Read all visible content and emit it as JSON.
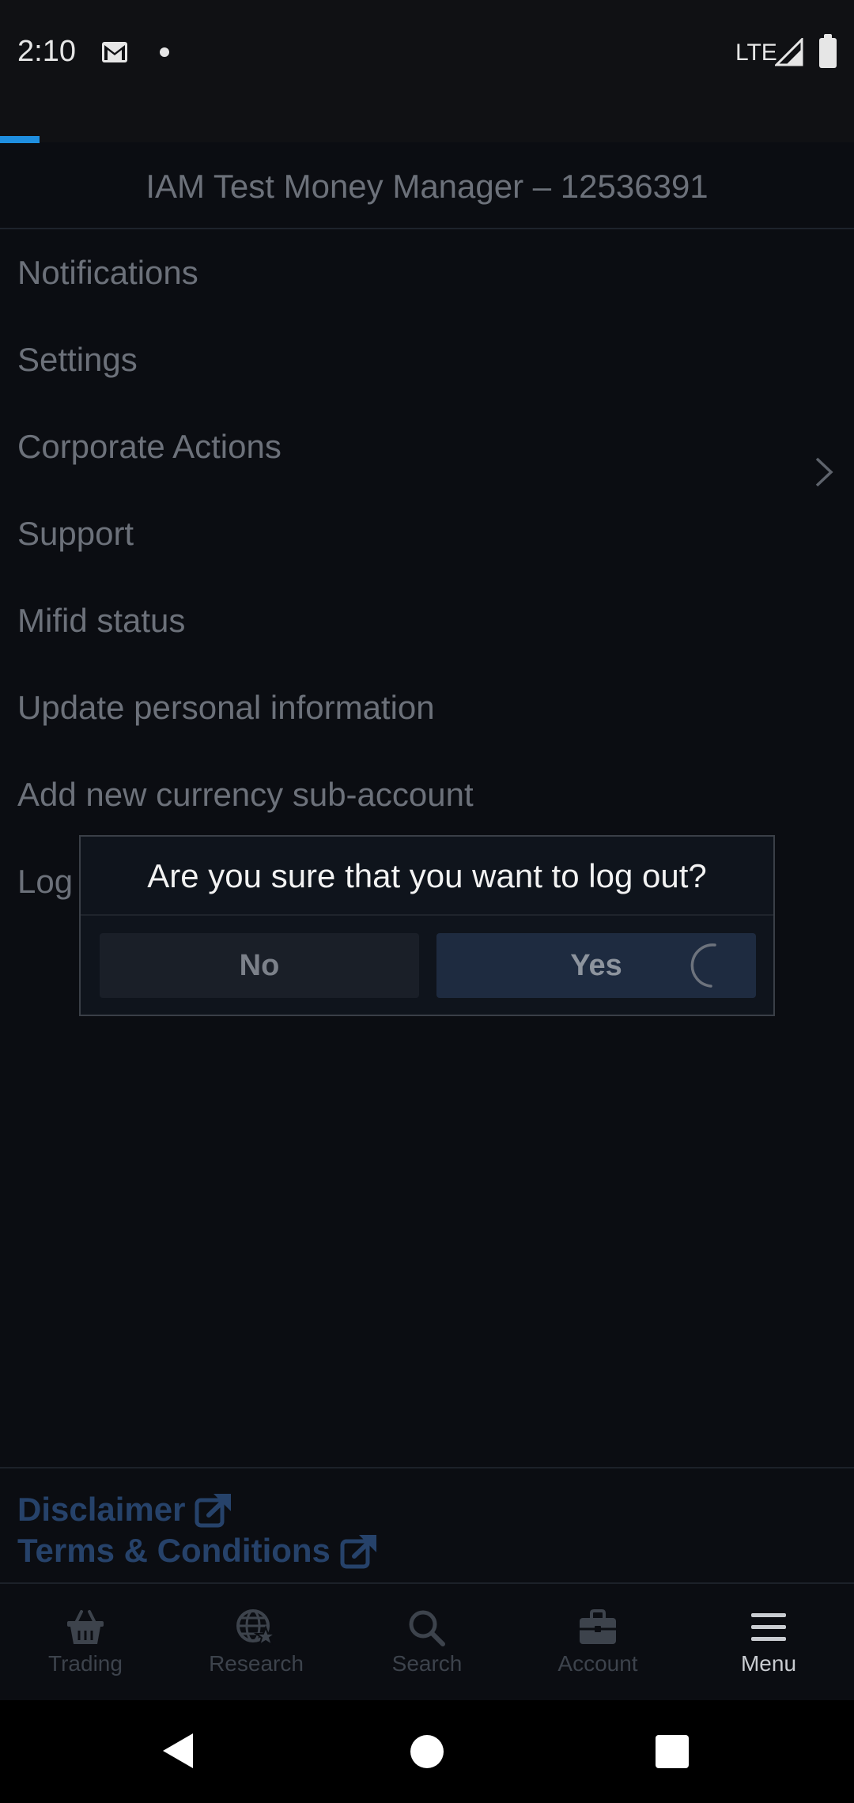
{
  "status_bar": {
    "time": "2:10",
    "network": "LTE",
    "icons": [
      "gmail-icon",
      "notification-dot-icon",
      "signal-icon",
      "battery-icon"
    ]
  },
  "header": {
    "account_title": "IAM Test Money Manager – 12536391"
  },
  "menu": {
    "items": [
      {
        "label": "Notifications"
      },
      {
        "label": "Settings"
      },
      {
        "label": "Corporate Actions",
        "has_chevron": true
      },
      {
        "label": "Support"
      },
      {
        "label": "Mifid status"
      },
      {
        "label": "Update personal information"
      },
      {
        "label": "Add new currency sub-account"
      },
      {
        "label": "Log"
      }
    ]
  },
  "dialog": {
    "question": "Are you sure that you want to log out?",
    "no_label": "No",
    "yes_label": "Yes"
  },
  "footer": {
    "disclaimer": "Disclaimer",
    "terms": "Terms & Conditions"
  },
  "tabs": [
    {
      "label": "Trading",
      "icon": "basket-icon"
    },
    {
      "label": "Research",
      "icon": "globe-star-icon"
    },
    {
      "label": "Search",
      "icon": "search-icon"
    },
    {
      "label": "Account",
      "icon": "briefcase-icon"
    },
    {
      "label": "Menu",
      "icon": "hamburger-menu-icon",
      "active": true
    }
  ],
  "colors": {
    "background": "#0b0d12",
    "accent_progress": "#1f8fe0",
    "link": "#26426a",
    "active_tab": "#c9ccd1"
  }
}
